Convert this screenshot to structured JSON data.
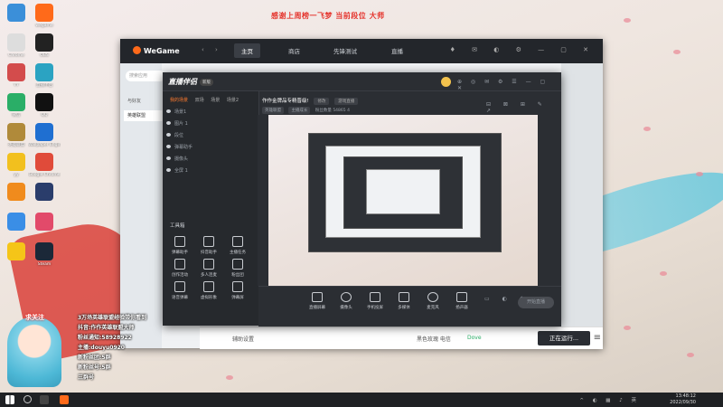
{
  "banner": "感谢上周榜一飞梦 当前段位 大师",
  "desktop_icons": [
    {
      "label": "",
      "color": "#3b8fd9",
      "name": "recycle-bin-icon"
    },
    {
      "label": "wegame",
      "color": "#ff6a1a",
      "name": "wegame-icon"
    },
    {
      "label": "Chrome",
      "color": "#dddddd",
      "name": "chrome-icon"
    },
    {
      "label": "OBS",
      "color": "#222222",
      "name": "obs-icon"
    },
    {
      "label": "YY",
      "color": "#d34c4c",
      "name": "yy-icon"
    },
    {
      "label": "直播伴侣",
      "color": "#2ba3c2",
      "name": "live-companion-icon"
    },
    {
      "label": "微信",
      "color": "#2aae67",
      "name": "wechat-icon"
    },
    {
      "label": "QQ",
      "color": "#111111",
      "name": "qq-icon"
    },
    {
      "label": "英雄联盟",
      "color": "#b08a3a",
      "name": "lol-icon"
    },
    {
      "label": "Wallpaper Engine",
      "color": "#1f6fd1",
      "name": "wallpaper-engine-icon"
    },
    {
      "label": "yy",
      "color": "#f2c01e",
      "name": "yy-app-icon"
    },
    {
      "label": "Google Chrome",
      "color": "#e04b3a",
      "name": "google-chrome-icon"
    },
    {
      "label": "",
      "color": "#f08b1d",
      "name": "app-orange-icon"
    },
    {
      "label": "",
      "color": "#2a3d6b",
      "name": "app-navy-icon"
    },
    {
      "label": "",
      "color": "#3a8ee6",
      "name": "app-blue-icon"
    },
    {
      "label": "",
      "color": "#e24a6a",
      "name": "app-pink-icon"
    },
    {
      "label": "",
      "color": "#f5c518",
      "name": "qq-music-icon"
    },
    {
      "label": "Steam",
      "color": "#1b2838",
      "name": "steam-icon"
    }
  ],
  "wegame": {
    "logo": "WeGame",
    "nav": [
      "主页",
      "商店",
      "先锋测试",
      "直播"
    ],
    "search_placeholder": "搜索应用",
    "left_items": [
      "与好友",
      "英雄联盟"
    ],
    "bottom_settings": "辅助设置",
    "bottom_status": "黑色玫瑰 电信",
    "bottom_mode": "Dove",
    "run_button": "正在运行..."
  },
  "zbb": {
    "logo": "直播伴侣",
    "badge": "新版",
    "tabs": [
      "我的场景",
      "双场",
      "场景",
      "场景2"
    ],
    "scenes": [
      "场景1",
      "图片 1",
      "段位",
      "弹幕助手",
      "摄像头",
      "全屏 1"
    ],
    "tool_section": "工具箱",
    "tools": [
      "弹幕助手",
      "抖音助手",
      "主播任务",
      "创作活动",
      "多人连麦",
      "粉丝团",
      "语音弹幕",
      "虚拟形象",
      "弹幕屏"
    ],
    "stream_title": "作作金牌品专精晋级!",
    "chip1": "修改",
    "chip2": "游戏直播",
    "sub1": "英雄联盟",
    "sub2": "主播成长",
    "sub3": "粉丝数量",
    "sub4": "54865",
    "sub5": "4",
    "bottom_tools": [
      "直播屏幕",
      "摄像头",
      "手机投屏",
      "多媒体",
      "麦克风",
      "扬声器"
    ],
    "start_button": "开始直播"
  },
  "overlay": {
    "follow": "求关注",
    "lines": [
      "3万场英雄联盟经验带你看到",
      "抖音:作作英雄联盟大师",
      "粉丝通知:58928922",
      "主播:douyu0920",
      "新粉丝团:5群",
      "新粉丝号:5群",
      "三群号"
    ]
  },
  "taskbar": {
    "time": "13:48:12",
    "date": "2022/09/30",
    "lang": "英"
  },
  "colors": {
    "accent": "#ff6a1a",
    "banner_red": "#e5332c",
    "zbb_bg": "#2b2e33"
  }
}
